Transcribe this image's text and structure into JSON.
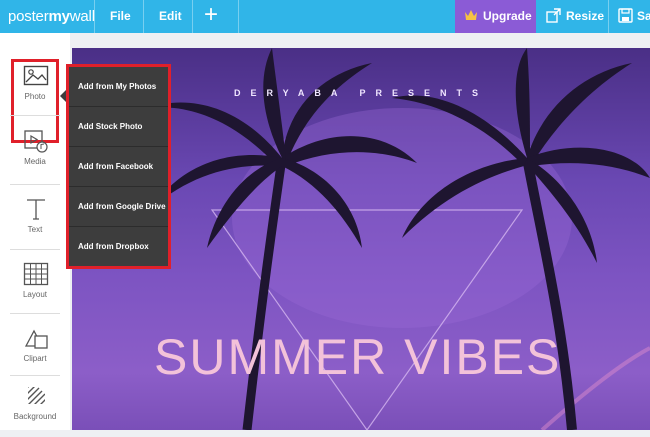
{
  "brand": {
    "logo_part1": "poster",
    "logo_part2": "my",
    "logo_part3": "wall"
  },
  "topbar": {
    "file_label": "File",
    "edit_label": "Edit",
    "add_symbol": "+",
    "upgrade_label": "Upgrade",
    "resize_label": "Resize",
    "save_label": "Sa",
    "colors": {
      "bar": "#30b5e8",
      "upgrade": "#8b5bd6"
    }
  },
  "sidebar": {
    "items": [
      {
        "label": "Photo",
        "icon": "image-icon"
      },
      {
        "label": "Media",
        "icon": "media-icon"
      },
      {
        "label": "Text",
        "icon": "text-icon"
      },
      {
        "label": "Layout",
        "icon": "grid-layout-icon"
      },
      {
        "label": "Clipart",
        "icon": "shapes-icon"
      },
      {
        "label": "Background",
        "icon": "pattern-icon"
      }
    ]
  },
  "photo_menu": {
    "items": [
      {
        "label": "Add from My Photos"
      },
      {
        "label": "Add Stock Photo"
      },
      {
        "label": "Add from Facebook"
      },
      {
        "label": "Add from Google Drive"
      },
      {
        "label": "Add from Dropbox"
      }
    ]
  },
  "poster": {
    "presents_text": "DERYABA PRESENTS",
    "headline": "SUMMER VIBES"
  }
}
